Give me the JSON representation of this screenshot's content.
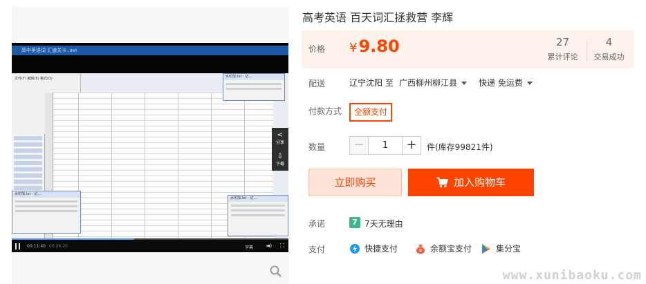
{
  "product": {
    "title": "高考英语 百天词汇拯救营 李辉"
  },
  "price": {
    "label": "价格",
    "currency_symbol": "¥",
    "amount": "9.80",
    "accent_color": "#ff4400"
  },
  "stats": {
    "reviews_count": "27",
    "reviews_label": "累计评论",
    "deals_count": "4",
    "deals_label": "交易成功"
  },
  "shipping": {
    "label": "配送",
    "from": "辽宁沈阳 至",
    "to": "广西柳州柳江县",
    "method": "快递 免运费"
  },
  "payment_mode": {
    "label": "付款方式",
    "option": "全额支付"
  },
  "quantity": {
    "label": "数量",
    "minus": "−",
    "value": "1",
    "plus": "+",
    "stock_text": "件(库存99821件)"
  },
  "actions": {
    "buy_now": "立即购买",
    "add_to_cart": "加入购物车"
  },
  "promise": {
    "label": "承诺",
    "icon_char": "7",
    "text": "7天无理由"
  },
  "payment_methods": {
    "label": "支付",
    "items": [
      {
        "icon": "quick-pay-icon",
        "label": "快捷支付"
      },
      {
        "icon": "yuebao-icon",
        "label": "余额宝支付"
      },
      {
        "icon": "jifen-icon",
        "label": "集分宝"
      }
    ]
  },
  "video": {
    "window_title": "高中英语词 汇速关卡 .avi",
    "current_time": "00:11:40",
    "total_time": "00:26:20",
    "progress": 0.443,
    "subtitle_label": "字幕",
    "side_share": "分享",
    "side_download": "下载",
    "popup_title": "水印加.txt - 记..."
  },
  "watermark": "www.xunibaoku.com"
}
